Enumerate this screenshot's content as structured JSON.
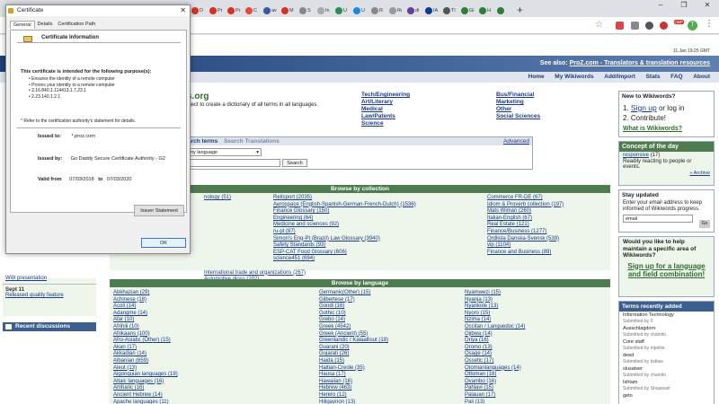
{
  "browser": {
    "tabs": [
      {
        "label": "4",
        "color": "#d93025"
      },
      {
        "label": "D",
        "color": "#d93025"
      },
      {
        "label": "Pr",
        "color": "#d93025"
      },
      {
        "label": "Pr",
        "color": "#d93025"
      },
      {
        "label": "C",
        "color": "#e8453c"
      },
      {
        "label": "av",
        "color": "#3b5998"
      },
      {
        "label": "M",
        "color": "#d93025"
      },
      {
        "label": "S",
        "color": "#888888"
      },
      {
        "label": "In",
        "color": "#aaaaaa"
      },
      {
        "label": "U",
        "color": "#2e8b57"
      },
      {
        "label": "U",
        "color": "#1e88e5"
      },
      {
        "label": "R",
        "color": "#888888"
      },
      {
        "label": "Rı",
        "color": "#999999"
      },
      {
        "label": "di",
        "color": "#6a3d9a"
      },
      {
        "label": "IA",
        "color": "#0a3d91"
      },
      {
        "label": "Tl",
        "color": "#555555"
      },
      {
        "label": "Gi",
        "color": "#2e7d32"
      },
      {
        "label": "H",
        "color": "#2e7d32"
      },
      {
        "label": "",
        "color": "#2e7d32"
      }
    ],
    "new_tab": "+",
    "window_controls": [
      "–",
      "❐",
      "✕"
    ],
    "extension_badge": "ABP",
    "avatar_letter": "T",
    "menu": "⋮",
    "star": "☆"
  },
  "page": {
    "date": "11 Jan 19:25 GMT",
    "banner_prefix": "See also: ",
    "banner_link": "ProZ.com - Translators & translation resources",
    "nav": [
      "Home",
      "My Wikiwords",
      "Add/Import",
      "Stats",
      "FAQ",
      "About"
    ],
    "site_name": "s.org",
    "intro1": "oject to create a dictionary of all terms in all languages.",
    "intro2": "s.",
    "categories_col1": [
      "Tech/Engineering",
      "Art/Literary",
      "Medical",
      "Law/Patents",
      "Science"
    ],
    "categories_col2": [
      "Bus/Financial",
      "Marketing",
      "Other",
      "Social Sciences"
    ],
    "search": {
      "tab_terms": "arch terms",
      "tab_translations": "Search Translations",
      "advanced": "Advanced",
      "language": "ny language",
      "button": "Search"
    },
    "collection_header": "Browse by collection",
    "collection_left": [
      "nology (51)",
      "",
      "",
      "",
      "",
      "",
      "",
      "",
      "",
      "",
      "",
      "International trade and organizations (267)",
      "Automotive gloss (202)"
    ],
    "collection_mid": [
      "Reitsport (2035)",
      "Aerospace (English-Spanish-German-French-Dutch) (1536)",
      "Finance Glossary (150)",
      "Engineering (64)",
      "Medicine and sciences (92)",
      "ru-pt (87)",
      "Simon's Eng-Pt (Brazil) Law Glossary (3940)",
      "Safety Standards (93)",
      "ESP-CAT Food Glossary (606)",
      "science451 (694)"
    ],
    "collection_right": [
      "Commerce FR-DE (67)",
      "Idiom & Proverb collection (197)",
      "Mats Wiman (260)",
      "Italian-English (67)",
      "Real Estate (121)",
      "Finance/Business (1277)",
      "Ordlista Danska-Svensk (539)",
      "vip (1104)",
      "Finance and Business (89)"
    ],
    "language_header": "Browse by language",
    "languages_col1": [
      "Abkhazian (29)",
      "Achinese (18)",
      "Acoli (14)",
      "Adangme (14)",
      "Afar (10)",
      "Afrihili (10)",
      "Afrikaans (100)",
      "Afro-Asiatic (Other) (15)",
      "Akan (17)",
      "Akkadian (14)",
      "Albanian (659)",
      "Aleut (13)",
      "Algonquian languages (19)",
      "Altaic languages (16)",
      "Amharic (16)",
      "Ancient Hebrew (14)",
      "Apache languages (11)"
    ],
    "languages_col2": [
      "Germanic(Other) (15)",
      "Gilbertese (17)",
      "Gondi (16)",
      "Gothic (10)",
      "Grebo (14)",
      "Greek (4542)",
      "Greek (Ancient) (55)",
      "Greenlandic / Kalaallisut (18)",
      "Guarani (20)",
      "Gujarati (26)",
      "Haida (15)",
      "Haitian-Creole (35)",
      "Hausa (17)",
      "Hawaiian (16)",
      "Hebrew (463)",
      "Herero (12)",
      "Hiligaynon (13)"
    ],
    "languages_col3": [
      "Nyamwezi (15)",
      "Nyanja (13)",
      "Nyankole (13)",
      "Nyoro (15)",
      "Nzima (14)",
      "Occitan / Languedoc (14)",
      "Ojibwa (14)",
      "Oriya (16)",
      "Oromo (13)",
      "Osage (14)",
      "Ossetic (17)",
      "Otomianlanguages (14)",
      "Ottoman (18)",
      "Ovambo (16)",
      "Pahlavi (15)",
      "Palauan (17)",
      "Pali (13)"
    ],
    "left_date": "Sept 11",
    "left_link": "Released quality feature",
    "left_link_top": "WW presentation",
    "recent_discussions": "Recent discussions"
  },
  "sidebar": {
    "new_title": "New to Wikiwords?",
    "step1_prefix": "1. ",
    "step1_link": "Sign up",
    "step1_suffix": " or log in",
    "step2": "2. Contribute!",
    "what_is": "What is Wikiwords?",
    "concept_title": "Concept of the day",
    "concept_word": "responsive",
    "concept_count": "(17)",
    "concept_def": "Readily reacting to people or events.",
    "archive": "» Archive",
    "stay_title": "Stay updated",
    "stay_text": "Enter your email address to keep informed of Wikiwords progress.",
    "email_placeholder": "email",
    "go": "Go",
    "maintain_text": "Would you like to help maintain a specific area of Wikiwords?",
    "signup_link": "Sign up for a language and field combination!",
    "terms_title": "Terms recently added",
    "terms": [
      {
        "term": "Information Technology",
        "by": "Submitted by 0"
      },
      {
        "term": "Ausschlagdorn",
        "by": "Submitted by chamito"
      },
      {
        "term": "Core staff",
        "by": "Submitted by mpelite"
      },
      {
        "term": "deed",
        "by": "Submitted by bstlaw"
      },
      {
        "term": "slusatser",
        "by": "Submitted by chamito"
      },
      {
        "term": "Ishtam",
        "by": "Submitted by Shojewah"
      },
      {
        "term": "geto",
        "by": ""
      }
    ]
  },
  "dialog": {
    "title": "Certificate",
    "close": "✕",
    "tabs": [
      "General",
      "Details",
      "Certification Path"
    ],
    "info_title": "Certificate Information",
    "purpose_heading": "This certificate is intended for the following purpose(s):",
    "purposes": [
      "• Ensures the identity of a remote computer",
      "• Proves your identity to a remote computer",
      "• 2.16.840.1.114413.1.7.23.1",
      "• 2.23.140.1.2.1"
    ],
    "refer": "* Refer to the certification authority's statement for details.",
    "issued_to_label": "Issued to:",
    "issued_to": "*.proz.com",
    "issued_by_label": "Issued by:",
    "issued_by": "Go Daddy Secure Certificate Authority - G2",
    "valid_from_label": "Valid from",
    "valid_from": "07/03/2018",
    "valid_to_label": "to",
    "valid_to": "07/03/2020",
    "issuer_button": "Issuer Statement",
    "ok_button": "OK"
  }
}
